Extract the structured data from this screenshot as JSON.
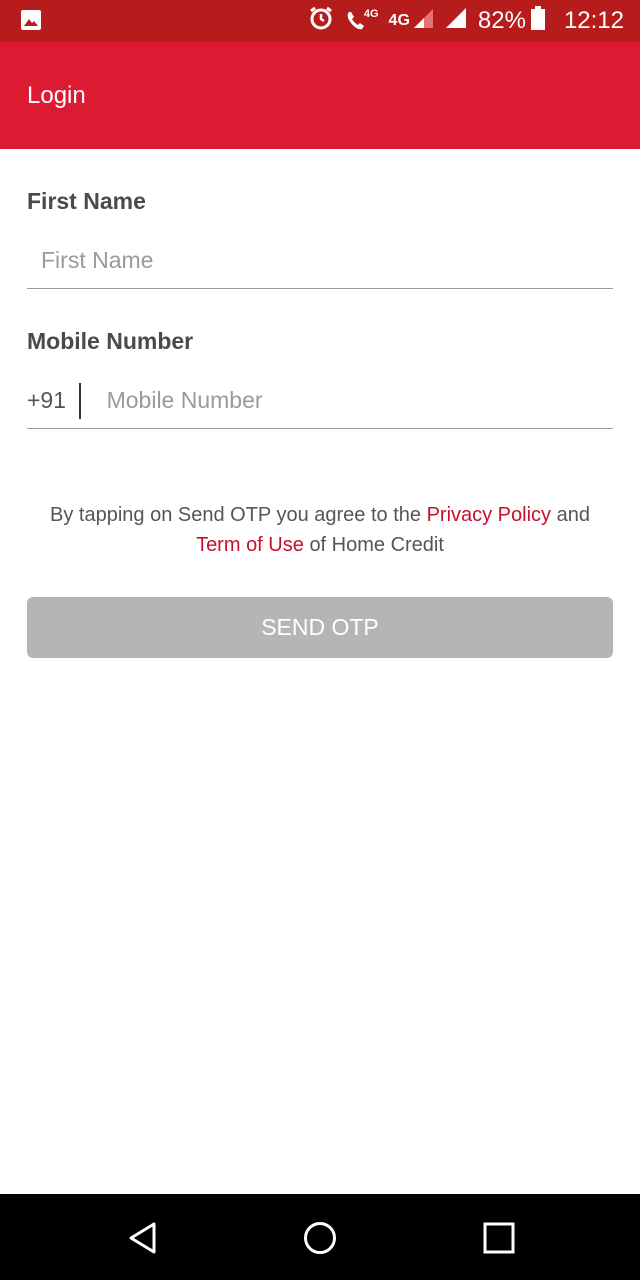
{
  "status_bar": {
    "gallery_icon": "image-icon",
    "alarm_icon": "alarm-icon",
    "call_icon": "volte-call-icon",
    "call_badge": "4G",
    "network_label": "4G",
    "battery_percent": "82%",
    "time": "12:12"
  },
  "app_bar": {
    "title": "Login"
  },
  "form": {
    "first_name_label": "First Name",
    "first_name_placeholder": "First Name",
    "first_name_value": "",
    "mobile_label": "Mobile Number",
    "country_code": "+91",
    "mobile_placeholder": "Mobile Number",
    "mobile_value": ""
  },
  "terms": {
    "prefix": "By tapping on Send OTP you agree to the",
    "privacy_link": "Privacy Policy",
    "and": "and",
    "terms_link": "Term of Use",
    "suffix": "of Home Credit"
  },
  "send_button": {
    "label": "SEND OTP",
    "color": "#b5b5b5"
  },
  "colors": {
    "status_bar": "#b71c1c",
    "app_bar": "#dc1a32",
    "link": "#c8102e"
  },
  "nav_bar": {
    "back_icon": "back-icon",
    "home_icon": "home-icon",
    "recents_icon": "recents-icon"
  }
}
